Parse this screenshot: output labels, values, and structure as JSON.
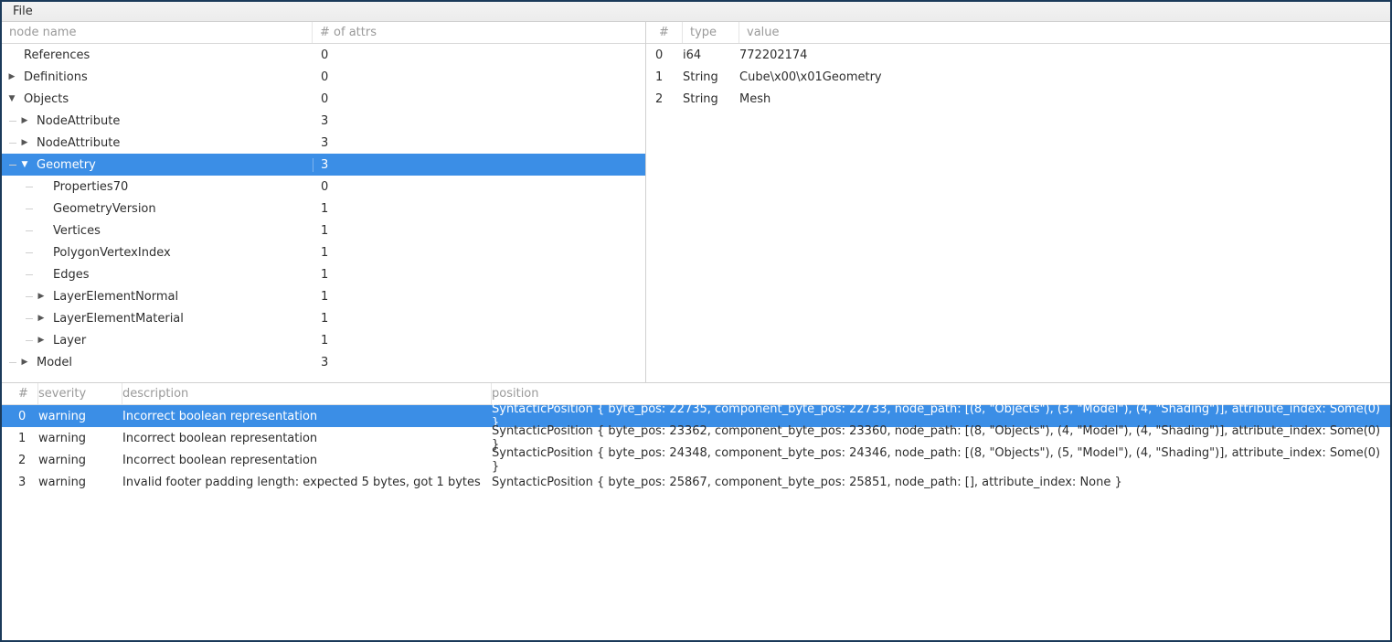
{
  "menubar": {
    "file": "File"
  },
  "tree": {
    "headers": {
      "name": "node name",
      "attrs": "# of attrs"
    },
    "rows": [
      {
        "depth": 0,
        "lines": [],
        "exp": "none",
        "label": "References",
        "attrs": "0",
        "sel": false
      },
      {
        "depth": 0,
        "lines": [],
        "exp": "closed",
        "label": "Definitions",
        "attrs": "0",
        "sel": false
      },
      {
        "depth": 0,
        "lines": [],
        "exp": "open",
        "label": "Objects",
        "attrs": "0",
        "sel": false
      },
      {
        "depth": 1,
        "lines": [
          "tee"
        ],
        "exp": "closed",
        "label": "NodeAttribute",
        "attrs": "3",
        "sel": false
      },
      {
        "depth": 1,
        "lines": [
          "tee"
        ],
        "exp": "closed",
        "label": "NodeAttribute",
        "attrs": "3",
        "sel": false
      },
      {
        "depth": 1,
        "lines": [
          "tee"
        ],
        "exp": "open",
        "label": "Geometry",
        "attrs": "3",
        "sel": true
      },
      {
        "depth": 2,
        "lines": [
          "branch",
          "tee"
        ],
        "exp": "none",
        "label": "Properties70",
        "attrs": "0",
        "sel": false
      },
      {
        "depth": 2,
        "lines": [
          "branch",
          "tee"
        ],
        "exp": "none",
        "label": "GeometryVersion",
        "attrs": "1",
        "sel": false
      },
      {
        "depth": 2,
        "lines": [
          "branch",
          "tee"
        ],
        "exp": "none",
        "label": "Vertices",
        "attrs": "1",
        "sel": false
      },
      {
        "depth": 2,
        "lines": [
          "branch",
          "tee"
        ],
        "exp": "none",
        "label": "PolygonVertexIndex",
        "attrs": "1",
        "sel": false
      },
      {
        "depth": 2,
        "lines": [
          "branch",
          "tee"
        ],
        "exp": "none",
        "label": "Edges",
        "attrs": "1",
        "sel": false
      },
      {
        "depth": 2,
        "lines": [
          "branch",
          "tee"
        ],
        "exp": "closed",
        "label": "LayerElementNormal",
        "attrs": "1",
        "sel": false
      },
      {
        "depth": 2,
        "lines": [
          "branch",
          "tee"
        ],
        "exp": "closed",
        "label": "LayerElementMaterial",
        "attrs": "1",
        "sel": false
      },
      {
        "depth": 2,
        "lines": [
          "branch",
          "end"
        ],
        "exp": "closed",
        "label": "Layer",
        "attrs": "1",
        "sel": false
      },
      {
        "depth": 1,
        "lines": [
          "end"
        ],
        "exp": "closed",
        "label": "Model",
        "attrs": "3",
        "sel": false
      }
    ]
  },
  "attrs": {
    "headers": {
      "idx": "#",
      "type": "type",
      "value": "value"
    },
    "rows": [
      {
        "idx": "0",
        "type": "i64",
        "value": "772202174"
      },
      {
        "idx": "1",
        "type": "String",
        "value": "Cube\\x00\\x01Geometry"
      },
      {
        "idx": "2",
        "type": "String",
        "value": "Mesh"
      }
    ]
  },
  "log": {
    "headers": {
      "idx": "#",
      "sev": "severity",
      "desc": "description",
      "pos": "position"
    },
    "rows": [
      {
        "idx": "0",
        "sev": "warning",
        "desc": "Incorrect boolean representation",
        "pos": "SyntacticPosition { byte_pos: 22735, component_byte_pos: 22733, node_path: [(8, \"Objects\"), (3, \"Model\"), (4, \"Shading\")], attribute_index: Some(0) }",
        "sel": true
      },
      {
        "idx": "1",
        "sev": "warning",
        "desc": "Incorrect boolean representation",
        "pos": "SyntacticPosition { byte_pos: 23362, component_byte_pos: 23360, node_path: [(8, \"Objects\"), (4, \"Model\"), (4, \"Shading\")], attribute_index: Some(0) }",
        "sel": false
      },
      {
        "idx": "2",
        "sev": "warning",
        "desc": "Incorrect boolean representation",
        "pos": "SyntacticPosition { byte_pos: 24348, component_byte_pos: 24346, node_path: [(8, \"Objects\"), (5, \"Model\"), (4, \"Shading\")], attribute_index: Some(0) }",
        "sel": false
      },
      {
        "idx": "3",
        "sev": "warning",
        "desc": "Invalid footer padding length: expected 5 bytes, got 1 bytes",
        "pos": "SyntacticPosition { byte_pos: 25867, component_byte_pos: 25851, node_path: [], attribute_index: None }",
        "sel": false
      }
    ]
  }
}
